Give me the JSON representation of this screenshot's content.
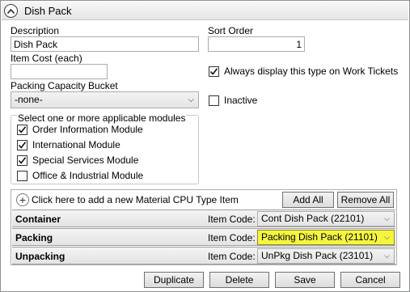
{
  "panel": {
    "title": "Dish Pack"
  },
  "form": {
    "description_label": "Description",
    "description_value": "Dish Pack",
    "sort_order_label": "Sort Order",
    "sort_order_value": "1",
    "item_cost_label": "Item Cost (each)",
    "item_cost_value": "",
    "always_display_label": "Always display this type on Work Tickets",
    "always_display_checked": true,
    "packing_bucket_label": "Packing Capacity Bucket",
    "packing_bucket_value": "-none-",
    "inactive_label": "Inactive",
    "inactive_checked": false
  },
  "modules": {
    "legend": "Select one or more applicable modules",
    "items": [
      {
        "label": "Order Information Module",
        "checked": true
      },
      {
        "label": "International Module",
        "checked": true
      },
      {
        "label": "Special Services Module",
        "checked": true
      },
      {
        "label": "Office & Industrial Module",
        "checked": false
      }
    ]
  },
  "material_list": {
    "add_text": "Click here to add a new Material CPU Type Item",
    "add_all_label": "Add All",
    "remove_all_label": "Remove All",
    "rows": [
      {
        "name": "Container",
        "code_label": "Item Code:",
        "code_value": "Cont Dish Pack (22101)",
        "highlight": false
      },
      {
        "name": "Packing",
        "code_label": "Item Code:",
        "code_value": "Packing Dish Pack (21101)",
        "highlight": true
      },
      {
        "name": "Unpacking",
        "code_label": "Item Code:",
        "code_value": "UnPkg Dish Pack (23101)",
        "highlight": false
      }
    ]
  },
  "footer": {
    "duplicate_label": "Duplicate",
    "delete_label": "Delete",
    "save_label": "Save",
    "cancel_label": "Cancel"
  },
  "colors": {
    "highlight": "#f5f540",
    "border": "#8e8f8f"
  }
}
